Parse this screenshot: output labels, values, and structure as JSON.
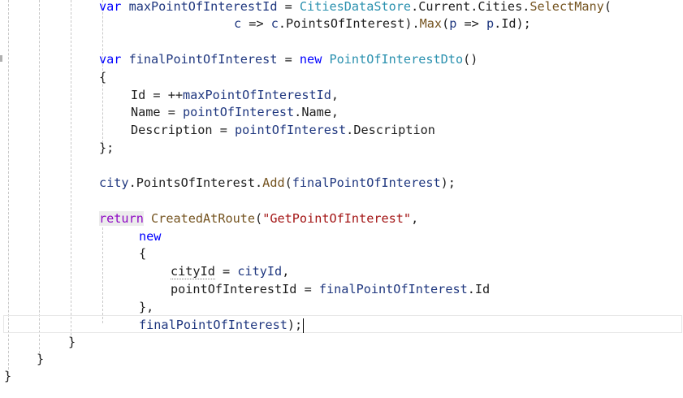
{
  "editor": {
    "lines": [
      {
        "tokens": [
          {
            "t": "var",
            "c": "kw"
          },
          {
            "t": " "
          },
          {
            "t": "maxPointOfInterestId",
            "c": "lv"
          },
          {
            "t": " = "
          },
          {
            "t": "CitiesDataStore",
            "c": "ty"
          },
          {
            "t": ".Current.Cities."
          },
          {
            "t": "SelectMany",
            "c": "mt"
          },
          {
            "t": "("
          }
        ]
      },
      {
        "tokens": [
          {
            "t": "c",
            "c": "lv"
          },
          {
            "t": " => "
          },
          {
            "t": "c",
            "c": "lv"
          },
          {
            "t": ".PointsOfInterest)."
          },
          {
            "t": "Max",
            "c": "mt"
          },
          {
            "t": "("
          },
          {
            "t": "p",
            "c": "lv"
          },
          {
            "t": " => "
          },
          {
            "t": "p",
            "c": "lv"
          },
          {
            "t": ".Id);"
          }
        ]
      },
      {
        "tokens": [
          {
            "t": "var",
            "c": "kw"
          },
          {
            "t": " "
          },
          {
            "t": "finalPointOfInterest",
            "c": "lv"
          },
          {
            "t": " = "
          },
          {
            "t": "new",
            "c": "kw"
          },
          {
            "t": " "
          },
          {
            "t": "PointOfInterestDto",
            "c": "ty"
          },
          {
            "t": "()"
          }
        ]
      },
      {
        "tokens": [
          {
            "t": "{"
          }
        ]
      },
      {
        "tokens": [
          {
            "t": "Id = ++"
          },
          {
            "t": "maxPointOfInterestId",
            "c": "lv"
          },
          {
            "t": ","
          }
        ]
      },
      {
        "tokens": [
          {
            "t": "Name = "
          },
          {
            "t": "pointOfInterest",
            "c": "lv"
          },
          {
            "t": ".Name,"
          }
        ]
      },
      {
        "tokens": [
          {
            "t": "Description = "
          },
          {
            "t": "pointOfInterest",
            "c": "lv"
          },
          {
            "t": ".Description"
          }
        ]
      },
      {
        "tokens": [
          {
            "t": "};"
          }
        ]
      },
      {
        "tokens": [
          {
            "t": "city",
            "c": "lv"
          },
          {
            "t": ".PointsOfInterest."
          },
          {
            "t": "Add",
            "c": "mt"
          },
          {
            "t": "("
          },
          {
            "t": "finalPointOfInterest",
            "c": "lv"
          },
          {
            "t": ");"
          }
        ]
      },
      {
        "tokens": [
          {
            "t": "return",
            "c": "ret"
          },
          {
            "t": " "
          },
          {
            "t": "CreatedAtRoute",
            "c": "mt"
          },
          {
            "t": "("
          },
          {
            "t": "\"GetPointOfInterest\"",
            "c": "st"
          },
          {
            "t": ","
          }
        ]
      },
      {
        "tokens": [
          {
            "t": "new",
            "c": "kw"
          }
        ]
      },
      {
        "tokens": [
          {
            "t": "{"
          }
        ]
      },
      {
        "tokens": [
          {
            "t": "cityId",
            "c": "sq"
          },
          {
            "t": " = "
          },
          {
            "t": "cityId",
            "c": "lv"
          },
          {
            "t": ","
          }
        ]
      },
      {
        "tokens": [
          {
            "t": "pointOfInterestId = "
          },
          {
            "t": "finalPointOfInterest",
            "c": "lv"
          },
          {
            "t": ".Id"
          }
        ]
      },
      {
        "tokens": [
          {
            "t": "},"
          }
        ]
      },
      {
        "tokens": [
          {
            "t": "finalPointOfInterest",
            "c": "lv"
          },
          {
            "t": ");"
          },
          {
            "t": "",
            "c": "caret"
          }
        ]
      },
      {
        "tokens": [
          {
            "t": "}"
          }
        ]
      },
      {
        "tokens": [
          {
            "t": "}"
          }
        ]
      },
      {
        "tokens": [
          {
            "t": "}"
          }
        ]
      }
    ]
  },
  "colors": {
    "keyword": "#0000ff",
    "control_keyword": "#8f08c4",
    "type": "#2b91af",
    "method": "#74531f",
    "local": "#1f377f",
    "string": "#a31515",
    "background": "#ffffff"
  }
}
